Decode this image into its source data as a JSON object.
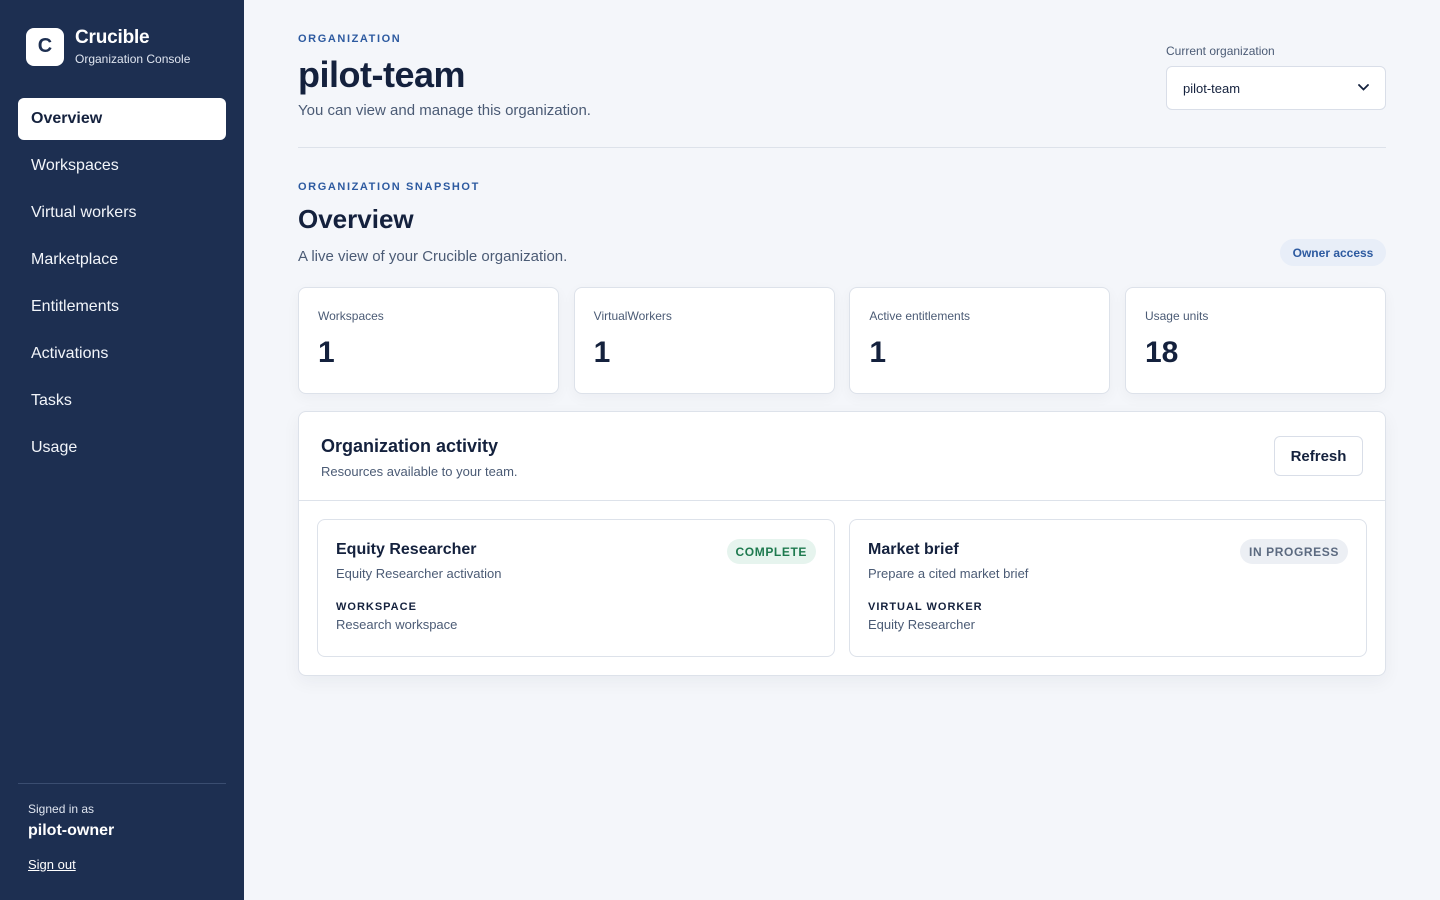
{
  "brand": {
    "logo_letter": "C",
    "name": "Crucible",
    "subtitle": "Organization Console"
  },
  "sidebar": {
    "items": [
      {
        "label": "Overview",
        "active": true
      },
      {
        "label": "Workspaces"
      },
      {
        "label": "Virtual workers"
      },
      {
        "label": "Marketplace"
      },
      {
        "label": "Entitlements"
      },
      {
        "label": "Activations"
      },
      {
        "label": "Tasks"
      },
      {
        "label": "Usage"
      }
    ],
    "signed_in_label": "Signed in as",
    "signed_in_user": "pilot-owner",
    "sign_out": "Sign out"
  },
  "header": {
    "eyebrow": "ORGANIZATION",
    "title": "pilot-team",
    "description": "You can view and manage this organization.",
    "select_label": "Current organization",
    "select_value": "pilot-team"
  },
  "snapshot": {
    "eyebrow": "ORGANIZATION SNAPSHOT",
    "title": "Overview",
    "description": "A live view of your Crucible organization.",
    "badge": "Owner access",
    "stats": [
      {
        "label": "Workspaces",
        "value": "1"
      },
      {
        "label": "VirtualWorkers",
        "value": "1"
      },
      {
        "label": "Active entitlements",
        "value": "1"
      },
      {
        "label": "Usage units",
        "value": "18"
      }
    ]
  },
  "activity": {
    "title": "Organization activity",
    "subtitle": "Resources available to your team.",
    "refresh_label": "Refresh",
    "cards": [
      {
        "title": "Equity Researcher",
        "description": "Equity Researcher activation",
        "status": "COMPLETE",
        "meta_label": "WORKSPACE",
        "meta_value": "Research workspace"
      },
      {
        "title": "Market brief",
        "description": "Prepare a cited market brief",
        "status": "IN PROGRESS",
        "meta_label": "VIRTUAL WORKER",
        "meta_value": "Equity Researcher"
      }
    ]
  },
  "icons": {
    "select_chevron": "chevron-down-icon"
  },
  "colors": {
    "sidebar_bg": "#1d2f51",
    "accent": "#2d5aa0",
    "complete": "#1e7a4f",
    "page_bg": "#f4f6fa"
  }
}
